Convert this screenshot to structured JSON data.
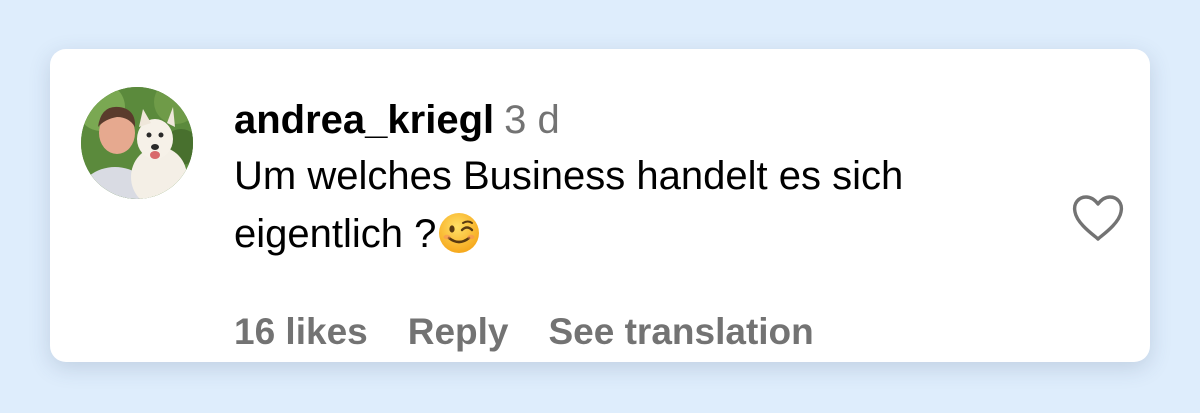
{
  "comment": {
    "username": "andrea_kriegl",
    "time_ago": "3 d",
    "text": "Um welches Business handelt es sich eigentlich ?",
    "emoji": "winking-face-emoji",
    "avatar_icon": "user-avatar-with-dog"
  },
  "actions": {
    "likes": "16 likes",
    "reply": "Reply",
    "see_translation": "See translation"
  },
  "like_icon": "heart-outline-icon",
  "colors": {
    "background": "#deedfc",
    "card": "#ffffff",
    "text_primary": "#000000",
    "text_secondary": "#737373"
  }
}
